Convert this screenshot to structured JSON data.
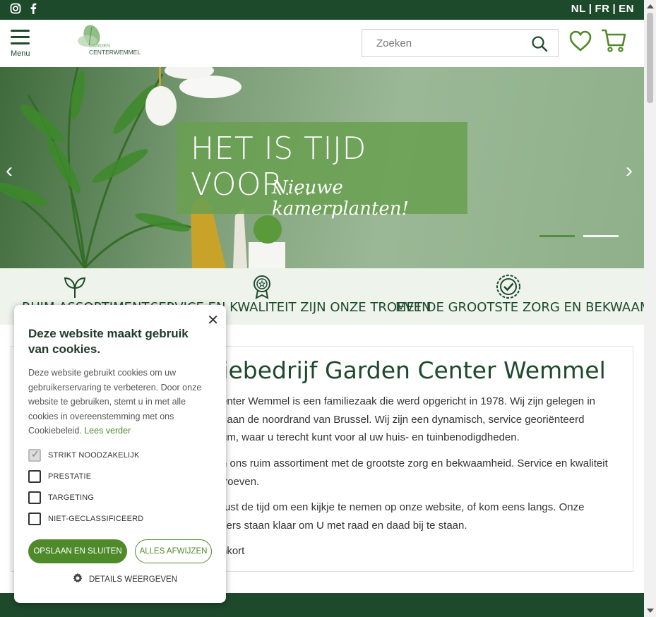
{
  "topbar": {
    "social": [
      "instagram-icon",
      "facebook-icon"
    ],
    "languages": [
      "NL",
      "FR",
      "EN"
    ],
    "separator": "|"
  },
  "header": {
    "menu_label": "Menu",
    "logo_text_1": "GARDEN",
    "logo_text_2": "CENTERWEMMEL",
    "search_placeholder": "Zoeken"
  },
  "hero": {
    "headline": "HET IS TIJD VOOR...",
    "script": "Nieuwe kamerplanten!",
    "slides_total": 2,
    "active_slide": 1
  },
  "usps": [
    {
      "label": "RUIM ASSORTIMENT",
      "icon": "plant-sprout-icon"
    },
    {
      "label": "SERVICE EN KWALITEIT ZIJN ONZE TROEVEN",
      "icon": "award-badge-icon"
    },
    {
      "label": "MET DE GROOTSTE ZORG EN BEKWAAMHEID",
      "icon": "check-badge-icon"
    }
  ],
  "content": {
    "title": "iliebedrijf Garden Center Wemmel",
    "p1_l1": "enter Wemmel is een familiezaak die werd opgericht in 1978. Wij zijn gelegen in",
    "p1_l2": ", aan de noordrand van Brussel. Wij zijn een dynamisch, service georiënteerd",
    "p1_l3": "um, waar u terecht kunt voor al uw huis- en tuinbenodigdheden.",
    "p2_l1": "n ons ruim assortiment met de grootste zorg en bekwaamheid. Service en kwaliteit",
    "p2_l2": "troeven.",
    "p3_l1": "rust de tijd om een kijkje te nemen op onze website, of kom eens langs. Onze",
    "p3_l2": "kers staan klaar om U met raad en daad bij te staan.",
    "p4": "nkort"
  },
  "cookie": {
    "title": "Deze website maakt gebruik van cookies.",
    "description": "Deze website gebruikt cookies om uw gebruikerservaring te verbeteren. Door onze website te gebruiken, stemt u in met alle cookies in overeenstemming met ons Cookiebeleid.",
    "read_more": "Lees verder",
    "options": [
      {
        "label": "STRIKT NOODZAKELIJK",
        "checked": true,
        "disabled": true
      },
      {
        "label": "PRESTATIE",
        "checked": false
      },
      {
        "label": "TARGETING",
        "checked": false
      },
      {
        "label": "NIET-GECLASSIFICEERD",
        "checked": false
      }
    ],
    "save_button": "OPSLAAN EN SLUITEN",
    "reject_button": "ALLES AFWIJZEN",
    "details_label": "DETAILS WEERGEVEN"
  },
  "colors": {
    "brand_dark": "#1e4a2c",
    "brand_green": "#4e8a2a",
    "hero_overlay": "#69a050"
  }
}
